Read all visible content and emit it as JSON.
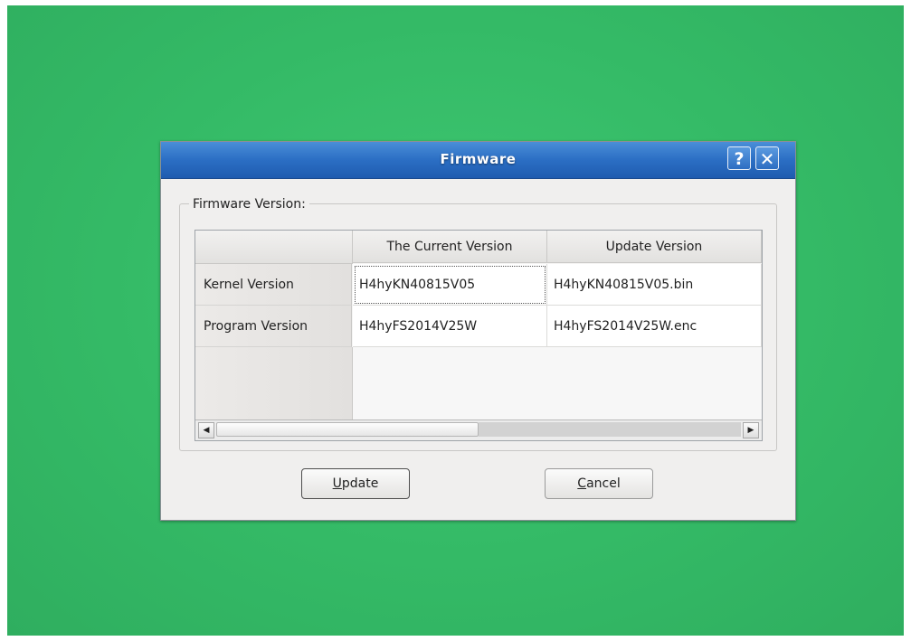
{
  "dialog": {
    "title": "Firmware",
    "help_glyph": "?",
    "close_glyph": "✕"
  },
  "group": {
    "label": "Firmware Version:"
  },
  "table": {
    "columns": [
      "The Current Version",
      "Update Version"
    ],
    "rows": [
      {
        "label": "Kernel Version",
        "current": "H4hyKN40815V05",
        "update": "H4hyKN40815V05.bin"
      },
      {
        "label": "Program Version",
        "current": "H4hyFS2014V25W",
        "update": "H4hyFS2014V25W.enc"
      }
    ]
  },
  "scrollbar": {
    "left_arrow": "◀",
    "right_arrow": "▶"
  },
  "buttons": {
    "update_mnemonic": "U",
    "update_rest": "pdate",
    "cancel_mnemonic": "C",
    "cancel_rest": "ancel"
  },
  "colors": {
    "screen_background": "#34ba66",
    "titlebar": "#2b6ec4",
    "dialog_background": "#f0efee"
  },
  "icons": [
    "help-icon",
    "close-icon",
    "scroll-left-icon",
    "scroll-right-icon"
  ]
}
